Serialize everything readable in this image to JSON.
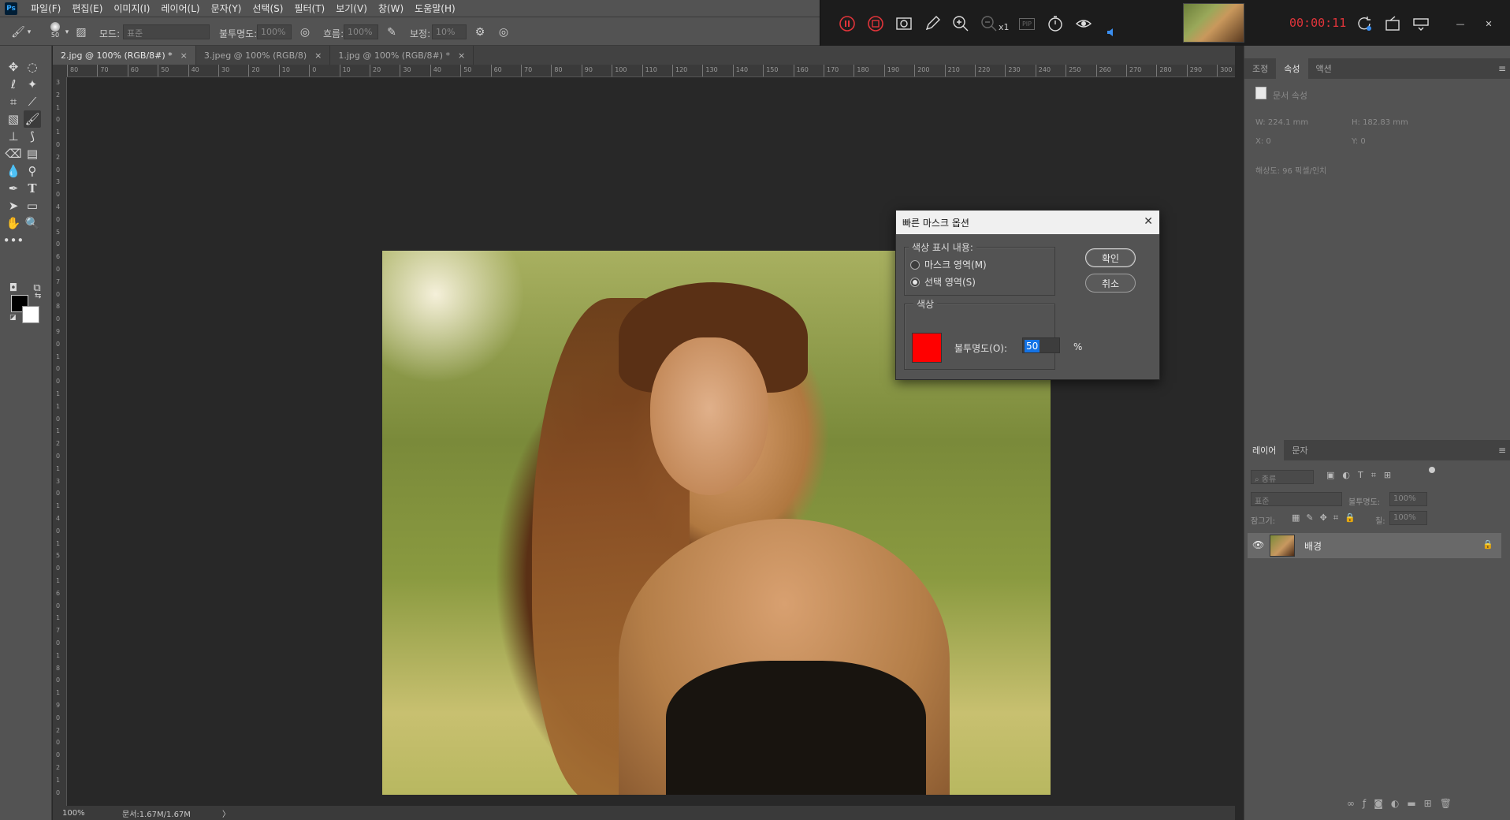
{
  "menubar": {
    "logo": "Ps",
    "items": [
      "파일(F)",
      "편집(E)",
      "이미지(I)",
      "레이어(L)",
      "문자(Y)",
      "선택(S)",
      "필터(T)",
      "보기(V)",
      "창(W)",
      "도움말(H)"
    ]
  },
  "recorder": {
    "time": "00:00:11",
    "zoom_multiplier": "x1",
    "pip_label": "PIP",
    "icons": [
      "pause-icon",
      "stop-icon",
      "screenshot-icon",
      "pencil-icon",
      "zoom-in-icon",
      "zoom-out-icon",
      "pip-icon",
      "timer-icon",
      "cursor-highlight-icon",
      "volume-icon",
      "refresh-icon",
      "capture-settings-icon",
      "overlay-icon",
      "minimize-icon",
      "close-icon"
    ]
  },
  "options": {
    "brush_size": "50",
    "mode_label": "모드:",
    "mode_value": "표준",
    "opacity_label": "불투명도:",
    "opacity_value": "100%",
    "flow_label": "흐름:",
    "flow_value": "100%",
    "smoothing_label": "보정:",
    "smoothing_value": "10%"
  },
  "tabs": [
    {
      "label": "2.jpg @ 100% (RGB/8#) *",
      "active": true
    },
    {
      "label": "3.jpeg @ 100% (RGB/8)",
      "active": false
    },
    {
      "label": "1.jpg @ 100% (RGB/8#) *",
      "active": false
    }
  ],
  "ruler": {
    "h_ticks": [
      "80",
      "70",
      "60",
      "50",
      "40",
      "30",
      "20",
      "10",
      "0",
      "10",
      "20",
      "30",
      "40",
      "50",
      "60",
      "70",
      "80",
      "90",
      "100",
      "110",
      "120",
      "130",
      "140",
      "150",
      "160",
      "170",
      "180",
      "190",
      "200",
      "210",
      "220",
      "230",
      "240",
      "250",
      "260",
      "270",
      "280",
      "290",
      "300"
    ],
    "v_ticks": [
      "3",
      "2",
      "1",
      "0",
      "1",
      "0",
      "2",
      "0",
      "3",
      "0",
      "4",
      "0",
      "5",
      "0",
      "6",
      "0",
      "7",
      "0",
      "8",
      "0",
      "9",
      "0",
      "1",
      "0",
      "0",
      "1",
      "1",
      "0",
      "1",
      "2",
      "0",
      "1",
      "3",
      "0",
      "1",
      "4",
      "0",
      "1",
      "5",
      "0",
      "1",
      "6",
      "0",
      "1",
      "7",
      "0",
      "1",
      "8",
      "0",
      "1",
      "9",
      "0",
      "2",
      "0",
      "0",
      "2",
      "1",
      "0"
    ]
  },
  "status": {
    "zoom": "100%",
    "doc_info": "문서:1.67M/1.67M",
    "arrow": "〉"
  },
  "properties_panel": {
    "tabs": [
      "조정",
      "속성",
      "액션"
    ],
    "active_tab": "속성",
    "section_title": "문서 속성",
    "width": "W: 224.1 mm",
    "height": "H: 182.83 mm",
    "x": "X: 0",
    "y": "Y: 0",
    "resolution": "해상도: 96 픽셀/인치"
  },
  "layers_panel": {
    "tabs": [
      "레이어",
      "문자"
    ],
    "active_tab": "레이어",
    "filter_label": "종류",
    "blend_mode": "표준",
    "opacity_label": "불투명도:",
    "opacity_value": "100%",
    "lock_label": "잠그기:",
    "fill_label": "칠:",
    "fill_value": "100%",
    "layers": [
      {
        "name": "배경",
        "visible": true,
        "locked": true
      }
    ]
  },
  "dialog": {
    "title": "빠른 마스크 옵션",
    "group1_label": "색상 표시 내용:",
    "option_mask": "마스크 영역(M)",
    "option_selection": "선택 영역(S)",
    "selected": "selection",
    "group2_label": "색상",
    "color": "#ff0000",
    "opacity_label": "불투명도(O):",
    "opacity_value": "50",
    "percent": "%",
    "ok_label": "확인",
    "cancel_label": "취소"
  }
}
